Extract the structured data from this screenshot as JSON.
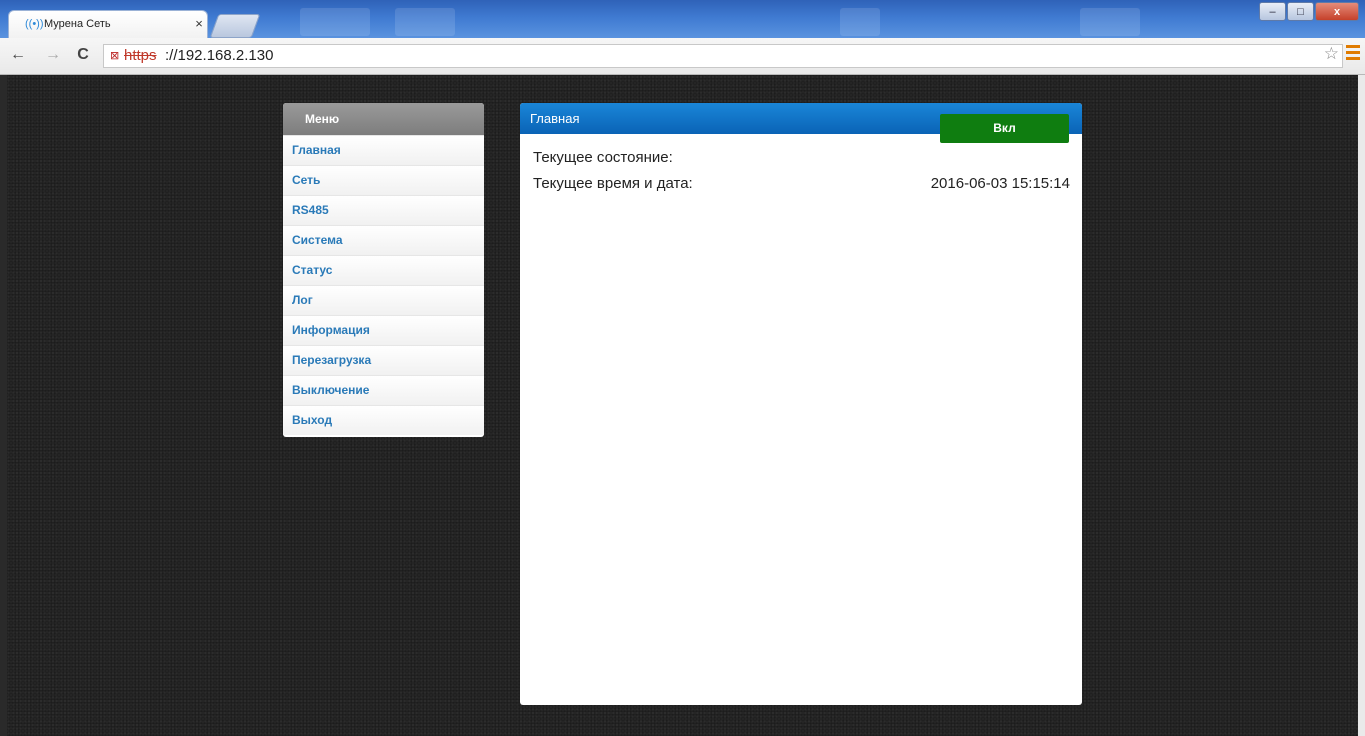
{
  "browser": {
    "tab_title": "Мурена Сеть",
    "tab_close": "×",
    "url_scheme": "https",
    "url_rest": "://192.168.2.130",
    "window_controls": {
      "minimize": "–",
      "maximize": "□",
      "close": "x"
    },
    "icons": {
      "back": "←",
      "forward": "→",
      "reload": "C",
      "star": "☆",
      "favicon": "((•))",
      "lock": "⊠"
    }
  },
  "menu": {
    "header": "Меню",
    "items": [
      "Главная",
      "Сеть",
      "RS485",
      "Система",
      "Статус",
      "Лог",
      "Информация",
      "Перезагрузка",
      "Выключение",
      "Выход"
    ]
  },
  "main": {
    "title": "Главная",
    "state_label": "Текущее состояние:",
    "state_button": "Вкл",
    "datetime_label": "Текущее время и дата:",
    "datetime_value": "2016-06-03 15:15:14"
  },
  "colors": {
    "accent_blue": "#0a63b6",
    "link_blue": "#2a7ab8",
    "on_green": "#0f7d10",
    "page_background": "#252525"
  }
}
